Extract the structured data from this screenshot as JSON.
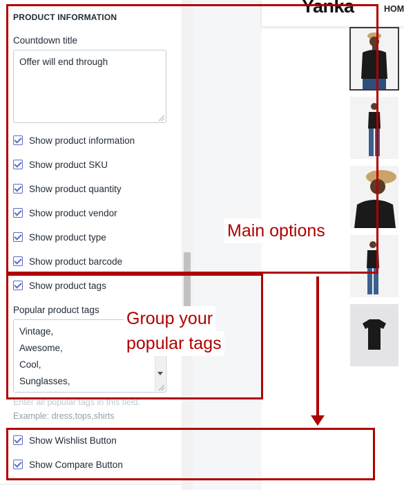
{
  "settings": {
    "section_title": "PRODUCT INFORMATION",
    "countdown": {
      "label": "Countdown title",
      "value": "Offer will end through"
    },
    "checkboxes_main": [
      {
        "label": "Show product information",
        "checked": true
      },
      {
        "label": "Show product SKU",
        "checked": true
      },
      {
        "label": "Show product quantity",
        "checked": true
      },
      {
        "label": "Show product vendor",
        "checked": true
      },
      {
        "label": "Show product type",
        "checked": true
      },
      {
        "label": "Show product barcode",
        "checked": true
      }
    ],
    "tags_checkbox": {
      "label": "Show product tags",
      "checked": true
    },
    "popular_tags": {
      "label": "Popular product tags",
      "lines": [
        "Vintage,",
        "Awesome,",
        "Cool,",
        "Sunglasses,"
      ],
      "help_line_1": "Enter all popular tags in this field.",
      "help_line_2": "Example: dress,tops,shirts"
    },
    "checkboxes_buttons": [
      {
        "label": "Show Wishlist Button",
        "checked": true
      },
      {
        "label": "Show Compare Button",
        "checked": true
      }
    ]
  },
  "store": {
    "logo": "Yanka",
    "nav_first": "HOM"
  },
  "annotations": {
    "main_options": "Main options",
    "group_tags_line1": "Group your",
    "group_tags_line2": "popular tags"
  },
  "colors": {
    "accent": "#5c6ac4",
    "annotation": "#b00000"
  }
}
